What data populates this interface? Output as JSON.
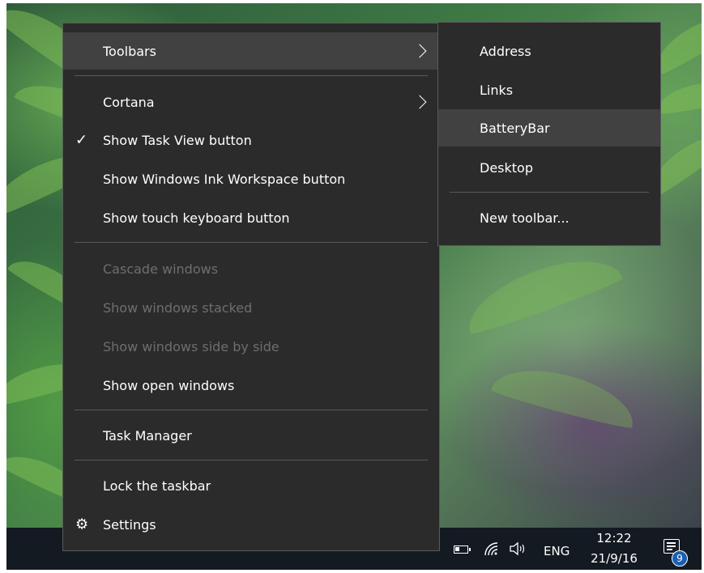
{
  "context_menu": {
    "toolbars": "Toolbars",
    "cortana": "Cortana",
    "show_task_view": "Show Task View button",
    "show_ink_workspace": "Show Windows Ink Workspace button",
    "show_touch_keyboard": "Show touch keyboard button",
    "cascade_windows": "Cascade windows",
    "show_stacked": "Show windows stacked",
    "show_side_by_side": "Show windows side by side",
    "show_open_windows": "Show open windows",
    "task_manager": "Task Manager",
    "lock_taskbar": "Lock the taskbar",
    "settings": "Settings",
    "checkmark": "✓",
    "gear_glyph": "⚙"
  },
  "toolbars_submenu": {
    "items": [
      "Address",
      "Links",
      "BatteryBar",
      "Desktop"
    ],
    "new_toolbar": "New toolbar...",
    "highlighted": "BatteryBar"
  },
  "taskbar": {
    "language": "ENG",
    "time": "12:22",
    "date": "21/9/16",
    "notification_count": "9",
    "icons": [
      "battery-icon",
      "wifi-icon",
      "volume-icon",
      "action-center-icon"
    ]
  },
  "colors": {
    "menu_background": "#2b2b2b",
    "menu_hover": "#414141",
    "disabled_text": "#6e6e6e",
    "taskbar": "#141a22",
    "badge": "#1b5fb0"
  }
}
